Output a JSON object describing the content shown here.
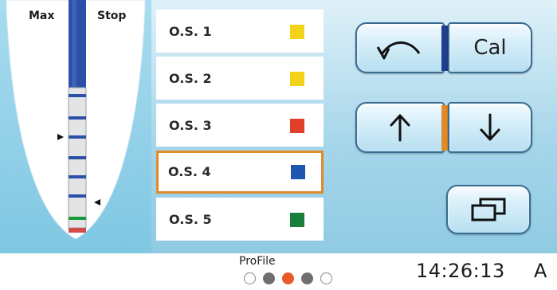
{
  "gauge": {
    "max_label": "Max",
    "stop_label": "Stop"
  },
  "file_list": [
    {
      "name": "O.S. 1",
      "color": "#f3d31a",
      "selected": false
    },
    {
      "name": "O.S. 2",
      "color": "#f3d31a",
      "selected": false
    },
    {
      "name": "O.S. 3",
      "color": "#e0402a",
      "selected": false
    },
    {
      "name": "O.S. 4",
      "color": "#1f57b0",
      "selected": true
    },
    {
      "name": "O.S. 5",
      "color": "#1a7f3a",
      "selected": false
    }
  ],
  "buttons": {
    "back_icon": "undo-arc-icon",
    "cal_label": "Cal",
    "up_icon": "arrow-up-icon",
    "down_icon": "arrow-down-icon",
    "windows_icon": "windows-icon"
  },
  "colors": {
    "accent_blue": "#1f3f8f",
    "accent_orange": "#e08a2a",
    "selection_border": "#e08a2a"
  },
  "status": {
    "system_name": "ProFile",
    "time": "14:26:13",
    "mode": "A",
    "page_dots": [
      {
        "state": "empty"
      },
      {
        "state": "filled"
      },
      {
        "state": "active"
      },
      {
        "state": "filled"
      },
      {
        "state": "empty"
      }
    ],
    "active_page": 3,
    "page_count": 5
  }
}
